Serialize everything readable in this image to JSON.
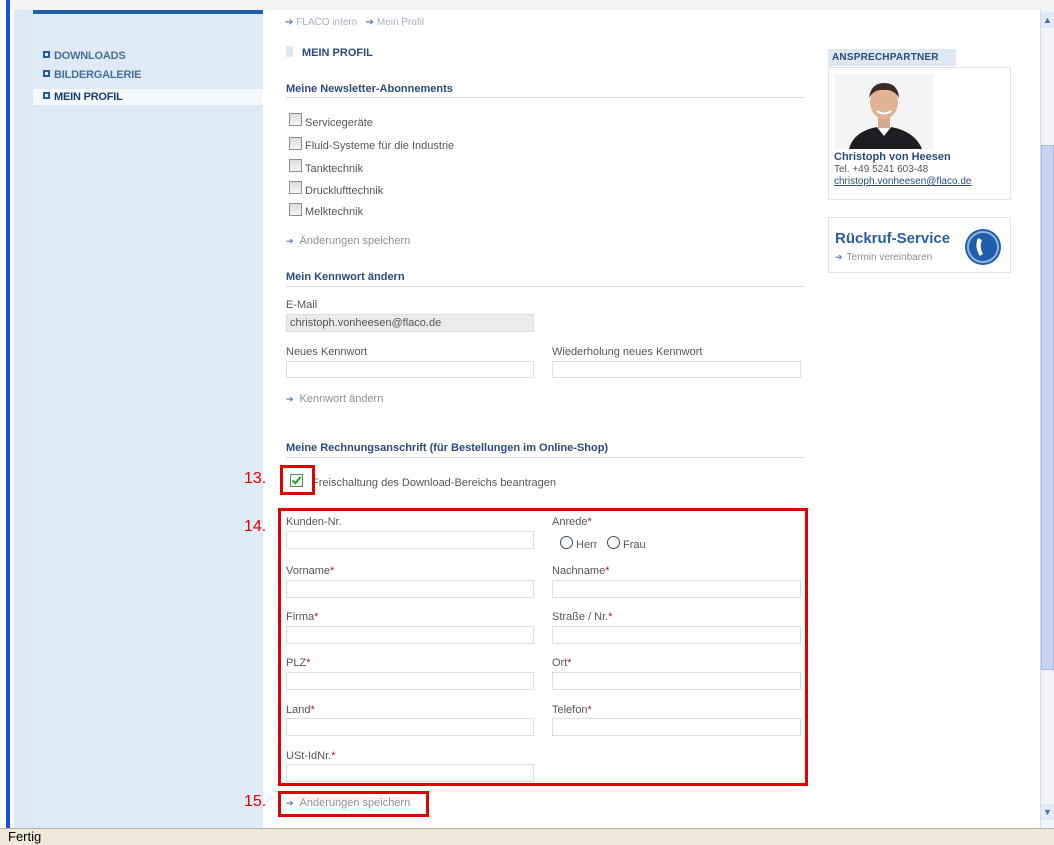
{
  "breadcrumb": {
    "items": [
      "FLACO intern",
      "Mein Profil"
    ]
  },
  "sidebar": {
    "items": [
      {
        "label": "DOWNLOADS"
      },
      {
        "label": "BILDERGALERIE"
      },
      {
        "label": "MEIN PROFIL",
        "active": true
      }
    ]
  },
  "page": {
    "title": "MEIN PROFIL"
  },
  "newsletter": {
    "title": "Meine Newsletter-Abonnements",
    "options": [
      {
        "label": "Servicegeräte",
        "checked": false
      },
      {
        "label": "Fluid-Systeme für die Industrie",
        "checked": false
      },
      {
        "label": "Tanktechnik",
        "checked": false
      },
      {
        "label": "Drucklufttechnik",
        "checked": false
      },
      {
        "label": "Melktechnik",
        "checked": false
      }
    ],
    "save_label": "Änderungen speichern"
  },
  "password": {
    "title": "Mein Kennwort ändern",
    "email_label": "E-Mail",
    "email_value": "christoph.vonheesen@flaco.de",
    "new_label": "Neues Kennwort",
    "repeat_label": "Wiederholung neues Kennwort",
    "change_label": "Kennwort ändern"
  },
  "billing": {
    "title": "Meine Rechnungsanschrift (für Bestellungen im Online-Shop)",
    "download_checkbox_label": "Freischaltung des Download-Bereichs beantragen",
    "download_checked": true,
    "fields": {
      "kunden_nr": "Kunden-Nr.",
      "anrede": "Anrede",
      "herr": "Herr",
      "frau": "Frau",
      "vorname": "Vorname",
      "nachname": "Nachname",
      "firma": "Firma",
      "strasse": "Straße / Nr.",
      "plz": "PLZ",
      "ort": "Ort",
      "land": "Land",
      "telefon": "Telefon",
      "ust": "USt-IdNr."
    },
    "required_mark": "*",
    "save_label": "Änderungen speichern"
  },
  "contact": {
    "title": "ANSPRECHPARTNER",
    "name": "Christoph von Heesen",
    "phone": "Tel. +49 5241 603-48",
    "email": "christoph.vonheesen@flaco.de"
  },
  "callback": {
    "title": "Rückruf-Service",
    "link": "Termin vereinbaren"
  },
  "annotations": {
    "n13": "13.",
    "n14": "14.",
    "n15": "15."
  },
  "status_bar": {
    "text": "Fertig"
  },
  "colors": {
    "accent": "#1f5ea8",
    "annotation": "#e00000",
    "required": "#c0141b"
  }
}
